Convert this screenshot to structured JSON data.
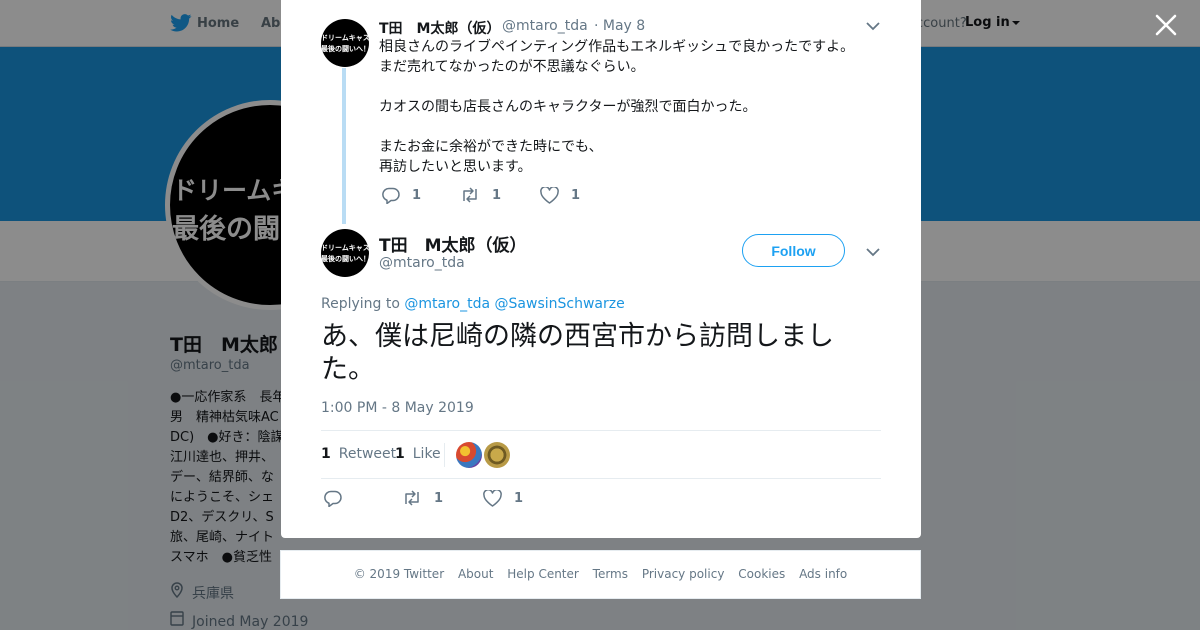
{
  "nav": {
    "home": "Home",
    "about": "Abo",
    "have_account": "ccount?",
    "login": "Log in"
  },
  "profile": {
    "name": "T田　M太郎（",
    "handle": "@mtaro_tda",
    "avatar_line1": "ドリームキャ",
    "avatar_line2": "最後の闘",
    "bio_lines": [
      "●一応作家系　長年",
      "男　精神枯気味AC",
      "DC)　●好き：陰謀",
      "江川達也、押井、",
      "デー、結界師、な",
      "にようこそ、シェ",
      "D2、デスクリ、S",
      "旅、尾崎、ナイト",
      "スマホ　●貧乏性"
    ],
    "location": "兵庫県",
    "joined": "Joined May 2019"
  },
  "parent_tweet": {
    "name": "T田　M太郎（仮）",
    "handle": "@mtaro_tda",
    "date": "· May 8",
    "avatar_line1": "ドリームキャスト",
    "avatar_line2": "最後の闘いへ！",
    "text_lines": [
      "相良さんのライブペインティング作品もエネルギッシュで良かったですよ。",
      "まだ売れてなかったのが不思議なぐらい。",
      "",
      "カオスの間も店長さんのキャラクターが強烈で面白かった。",
      "",
      "またお金に余裕ができた時にでも、",
      "再訪したいと思います。"
    ],
    "reply_count": "1",
    "retweet_count": "1",
    "like_count": "1"
  },
  "main_tweet": {
    "name": "T田　M太郎（仮）",
    "handle": "@mtaro_tda",
    "follow_label": "Follow",
    "replying_prefix": "Replying to",
    "replying_to": [
      "@mtaro_tda",
      "@SawsinSchwarze"
    ],
    "text": "あ、僕は尼崎の隣の西宮市から訪問しました。",
    "timestamp": "1:00 PM - 8 May 2019",
    "retweets_num": "1",
    "retweets_label": "Retweet",
    "likes_num": "1",
    "likes_label": "Like",
    "retweet_count": "1",
    "like_count": "1"
  },
  "footer": {
    "copyright": "© 2019 Twitter",
    "links": [
      "About",
      "Help Center",
      "Terms",
      "Privacy policy",
      "Cookies",
      "Ads info"
    ]
  },
  "colors": {
    "accent": "#1da1f2",
    "banner": "#1b95e0",
    "thread_line": "#b9dcf4"
  }
}
